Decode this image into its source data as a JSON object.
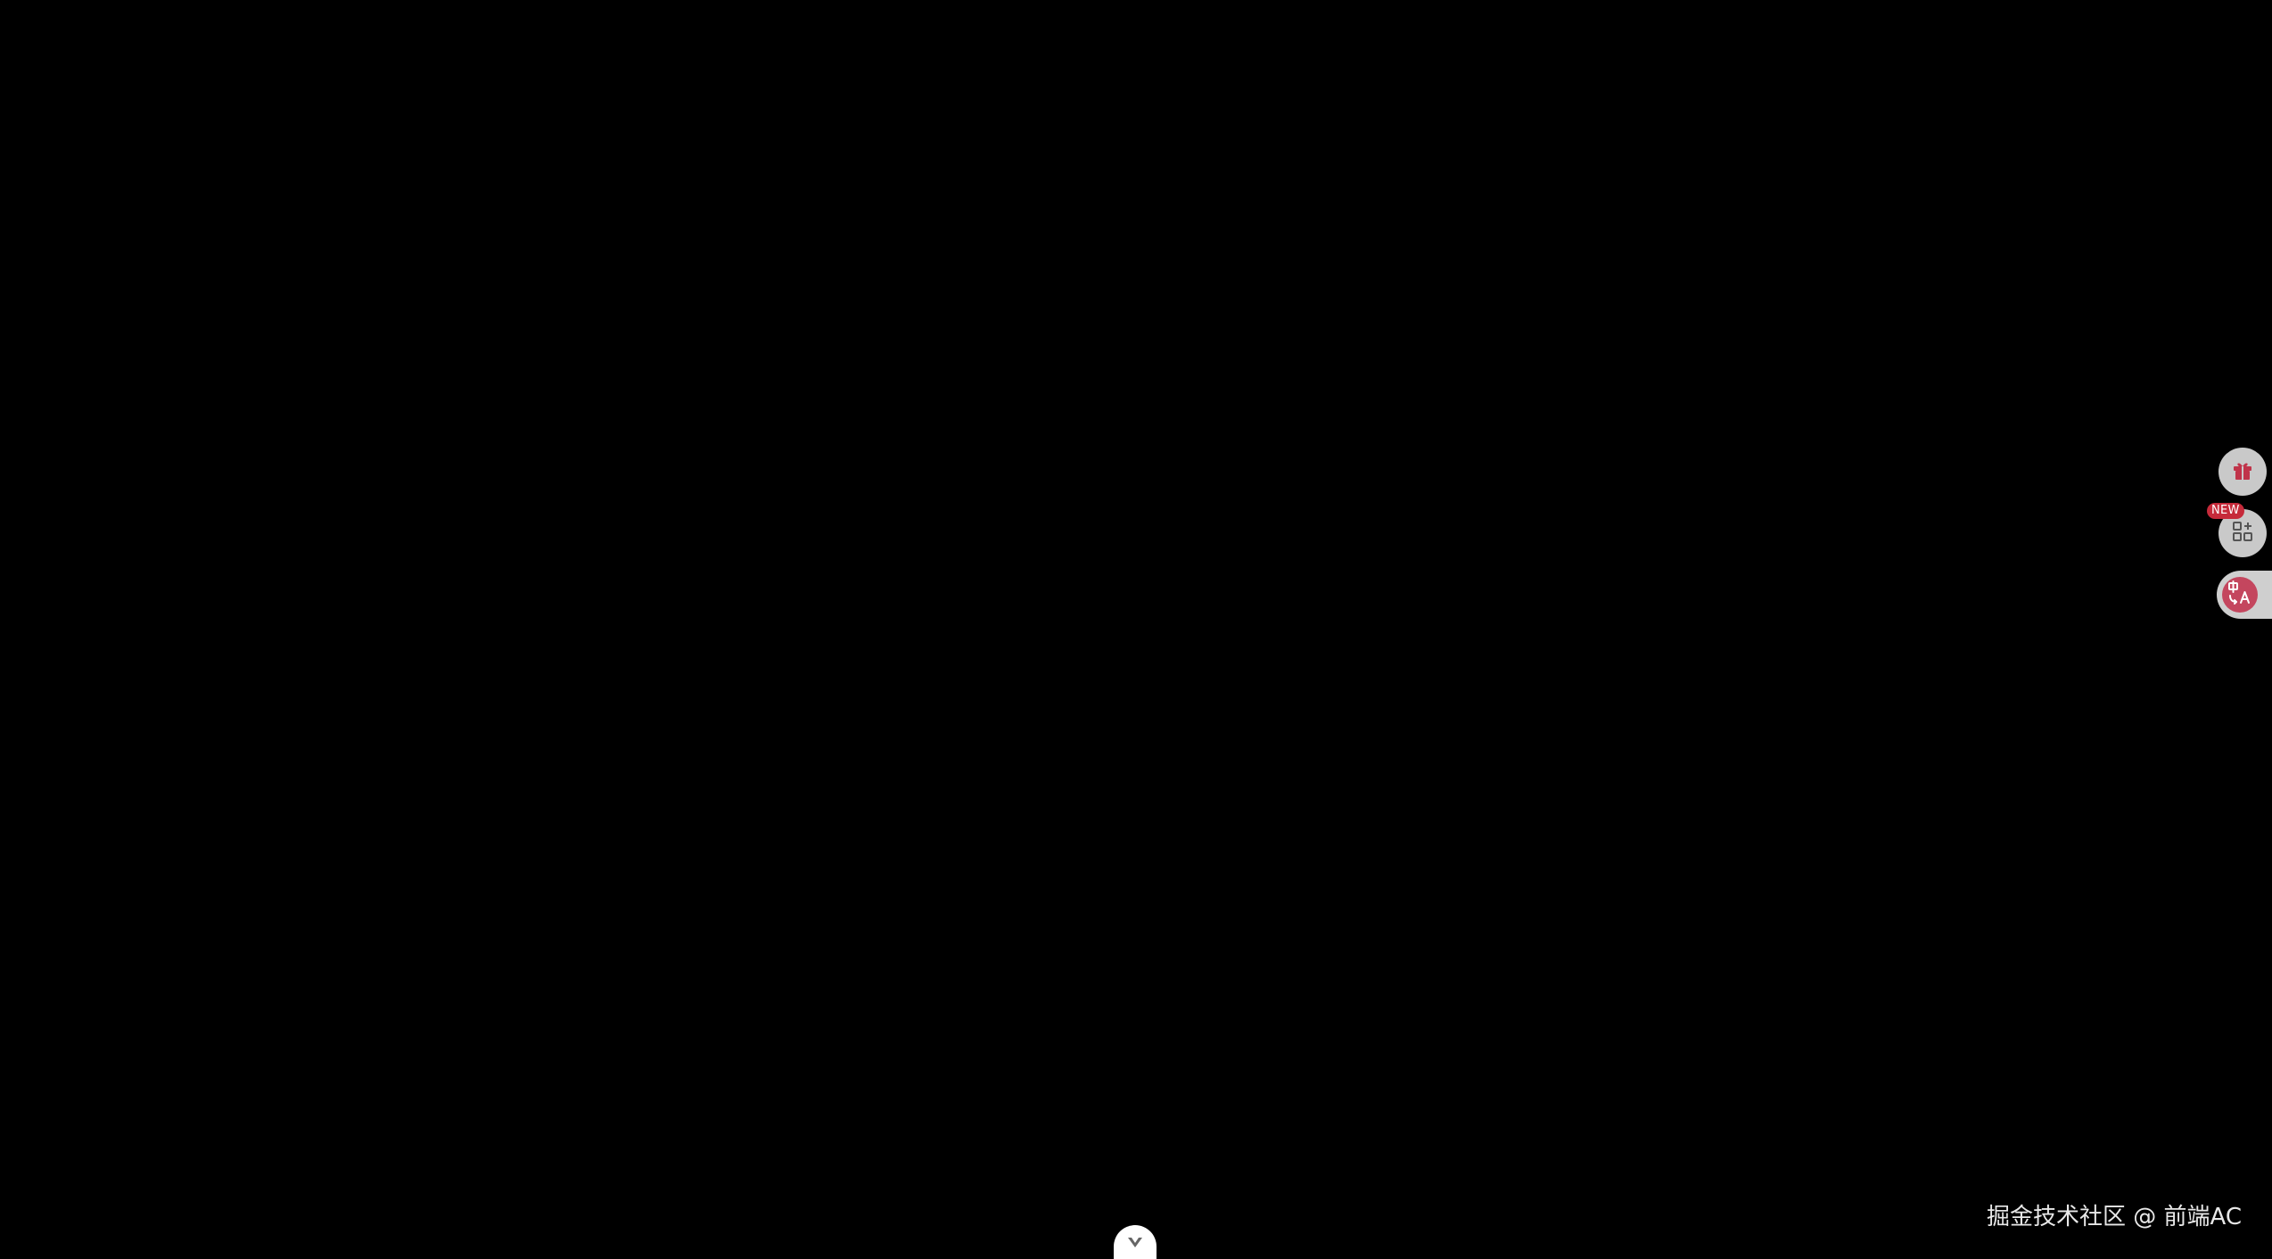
{
  "theme": {
    "background": "#000000",
    "button_gray": "#c9c9c9",
    "accent_red": "#c0344a",
    "badge_red": "#c62a3a",
    "translate_pink": "#c4465e",
    "scroll_tab": "#ffffff"
  },
  "floating_tools": [
    {
      "id": "gift",
      "icon": "gift-icon"
    },
    {
      "id": "apps",
      "icon": "apps-grid-icon",
      "badge": "NEW"
    },
    {
      "id": "translate",
      "icon": "translate-icon"
    }
  ],
  "scroll_control": {
    "icon": "chevron-down-icon"
  },
  "watermark": {
    "text": "掘金技术社区 @ 前端AC"
  }
}
